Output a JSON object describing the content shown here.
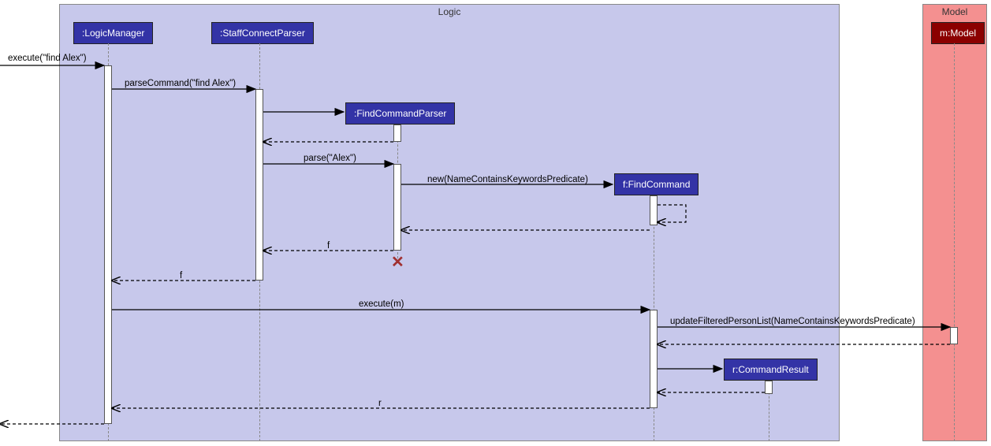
{
  "frames": {
    "logic": {
      "label": "Logic"
    },
    "model": {
      "label": "Model"
    }
  },
  "participants": {
    "logicManager": ":LogicManager",
    "staffConnectParser": ":StaffConnectParser",
    "findCommandParser": ":FindCommandParser",
    "findCommand": "f:FindCommand",
    "commandResult": "r:CommandResult",
    "model": "m:Model"
  },
  "messages": {
    "execute_in": "execute(\"find Alex\")",
    "parseCommand": "parseCommand(\"find Alex\")",
    "parse": "parse(\"Alex\")",
    "newCmd": "new(NameContainsKeywordsPredicate)",
    "ret_f1": "f",
    "ret_f2": "f",
    "executeM": "execute(m)",
    "updateFiltered": "updateFilteredPersonList(NameContainsKeywordsPredicate)",
    "ret_r": "r"
  },
  "chart_data": {
    "type": "sequence-diagram",
    "frames": [
      {
        "name": "Logic",
        "participants": [
          ":LogicManager",
          ":StaffConnectParser",
          ":FindCommandParser",
          "f:FindCommand",
          "r:CommandResult"
        ]
      },
      {
        "name": "Model",
        "participants": [
          "m:Model"
        ]
      }
    ],
    "participants": [
      ":LogicManager",
      ":StaffConnectParser",
      ":FindCommandParser",
      "f:FindCommand",
      "m:Model",
      "r:CommandResult"
    ],
    "messages": [
      {
        "from": "external",
        "to": ":LogicManager",
        "label": "execute(\"find Alex\")",
        "type": "sync"
      },
      {
        "from": ":LogicManager",
        "to": ":StaffConnectParser",
        "label": "parseCommand(\"find Alex\")",
        "type": "sync"
      },
      {
        "from": ":StaffConnectParser",
        "to": ":FindCommandParser",
        "label": "<<create>>",
        "type": "sync"
      },
      {
        "from": ":FindCommandParser",
        "to": ":StaffConnectParser",
        "label": "",
        "type": "return"
      },
      {
        "from": ":StaffConnectParser",
        "to": ":FindCommandParser",
        "label": "parse(\"Alex\")",
        "type": "sync"
      },
      {
        "from": ":FindCommandParser",
        "to": "f:FindCommand",
        "label": "new(NameContainsKeywordsPredicate)",
        "type": "sync"
      },
      {
        "from": "f:FindCommand",
        "to": "f:FindCommand",
        "label": "",
        "type": "return-self"
      },
      {
        "from": "f:FindCommand",
        "to": ":FindCommandParser",
        "label": "",
        "type": "return"
      },
      {
        "from": ":FindCommandParser",
        "to": ":StaffConnectParser",
        "label": "f",
        "type": "return"
      },
      {
        "from": ":FindCommandParser",
        "to": null,
        "label": "",
        "type": "destroy"
      },
      {
        "from": ":StaffConnectParser",
        "to": ":LogicManager",
        "label": "f",
        "type": "return"
      },
      {
        "from": ":LogicManager",
        "to": "f:FindCommand",
        "label": "execute(m)",
        "type": "sync"
      },
      {
        "from": "f:FindCommand",
        "to": "m:Model",
        "label": "updateFilteredPersonList(NameContainsKeywordsPredicate)",
        "type": "sync"
      },
      {
        "from": "m:Model",
        "to": "f:FindCommand",
        "label": "",
        "type": "return"
      },
      {
        "from": "f:FindCommand",
        "to": "r:CommandResult",
        "label": "<<create>>",
        "type": "sync"
      },
      {
        "from": "r:CommandResult",
        "to": "f:FindCommand",
        "label": "",
        "type": "return"
      },
      {
        "from": "f:FindCommand",
        "to": ":LogicManager",
        "label": "r",
        "type": "return"
      },
      {
        "from": ":LogicManager",
        "to": "external",
        "label": "",
        "type": "return"
      }
    ]
  }
}
